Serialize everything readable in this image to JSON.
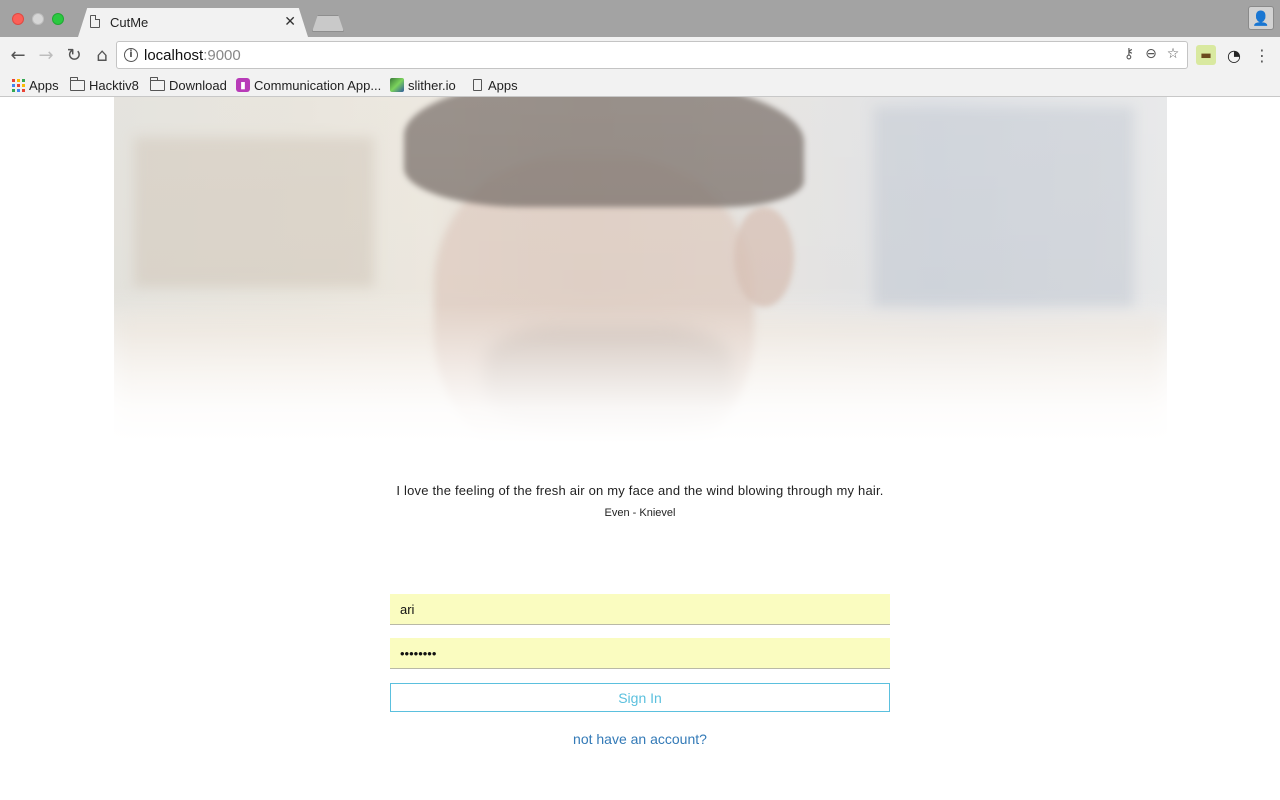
{
  "browser": {
    "tab_title": "CutMe",
    "url_host": "localhost",
    "url_port": ":9000",
    "bookmarks": [
      {
        "label": "Apps",
        "icon": "apps-grid-icon"
      },
      {
        "label": "Hacktiv8",
        "icon": "folder-icon"
      },
      {
        "label": "Download",
        "icon": "folder-icon"
      },
      {
        "label": "Communication App...",
        "icon": "communication-app-icon"
      },
      {
        "label": "slither.io",
        "icon": "slither-icon"
      },
      {
        "label": "Apps",
        "icon": "page-icon"
      }
    ]
  },
  "hero": {
    "quote": "I love the feeling of the fresh air on my face and the wind blowing through my hair.",
    "author": "Even - Knievel"
  },
  "login": {
    "username_value": "ari",
    "password_value": "ari12345",
    "signin_label": "Sign In",
    "register_link": "not have an account?"
  },
  "colors": {
    "input_autofill_bg": "#fafcc0",
    "signin_accent": "#5bc0de",
    "link": "#337ab7"
  }
}
